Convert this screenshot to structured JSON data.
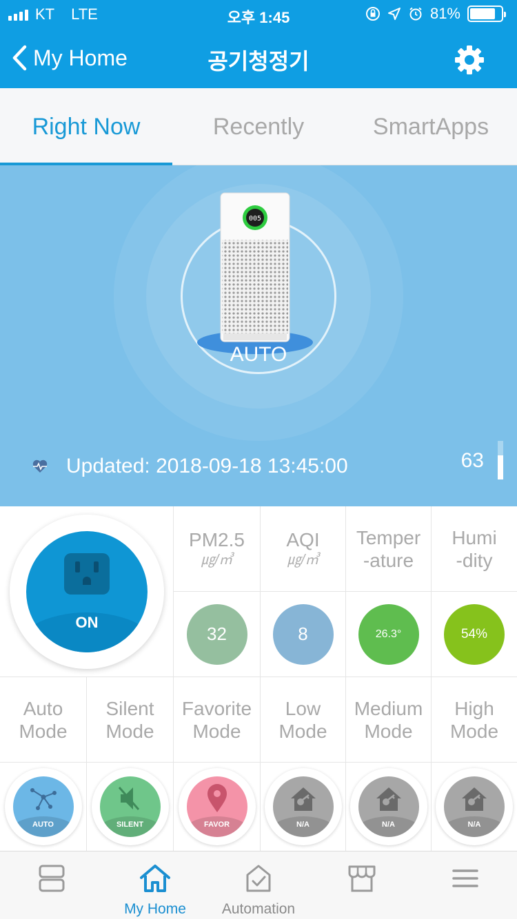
{
  "status_bar": {
    "carrier": "KT",
    "network": "LTE",
    "time": "오후 1:45",
    "battery_text": "81%",
    "battery_level": 0.81
  },
  "navbar": {
    "back_label": "My Home",
    "title": "공기청정기"
  },
  "tabs": [
    {
      "label": "Right Now",
      "active": true
    },
    {
      "label": "Recently",
      "active": false
    },
    {
      "label": "SmartApps",
      "active": false
    }
  ],
  "device": {
    "display_reading": "005",
    "mode": "AUTO",
    "updated_text": "Updated: 2018-09-18 13:45:00",
    "aqi_value": "63",
    "aqi_level": 0.63
  },
  "power": {
    "label": "ON",
    "color": "#0f96d4"
  },
  "metrics": [
    {
      "label": "PM2.5",
      "unit": "㎍/㎥",
      "value": "32",
      "color": "#95bf9f"
    },
    {
      "label": "AQI",
      "unit": "㎍/㎥",
      "value": "8",
      "color": "#87b5d6"
    },
    {
      "label": "Temper\n-ature",
      "value": "26.3°",
      "color": "#5fbd4f"
    },
    {
      "label": "Humi\n-dity",
      "value": "54%",
      "color": "#86c21c"
    }
  ],
  "modes": [
    {
      "label": "Auto\nMode",
      "badge": "AUTO",
      "color": "#6cb7e6",
      "icon": "network-icon"
    },
    {
      "label": "Silent\nMode",
      "badge": "SILENT",
      "color": "#6fc68a",
      "icon": "mute-speaker-icon"
    },
    {
      "label": "Favorite\nMode",
      "badge": "FAVOR",
      "color": "#f493a8",
      "icon": "location-pin-icon"
    },
    {
      "label": "Low\nMode",
      "badge": "N/A",
      "color": "#a7a7a7",
      "icon": "house-key-icon"
    },
    {
      "label": "Medium\nMode",
      "badge": "N/A",
      "color": "#a7a7a7",
      "icon": "house-key-icon"
    },
    {
      "label": "High\nMode",
      "badge": "N/A",
      "color": "#a7a7a7",
      "icon": "house-key-icon"
    }
  ],
  "bottom_nav": [
    {
      "label": "",
      "icon": "dashboard-icon",
      "active": false
    },
    {
      "label": "My Home",
      "icon": "home-icon",
      "active": true
    },
    {
      "label": "Automation",
      "icon": "automation-icon",
      "active": false
    },
    {
      "label": "",
      "icon": "store-icon",
      "active": false
    },
    {
      "label": "",
      "icon": "menu-icon",
      "active": false
    }
  ],
  "colors": {
    "brand": "#0f9ee3",
    "hero_bg": "#7cc0e9",
    "active_tab": "#1899d6"
  }
}
